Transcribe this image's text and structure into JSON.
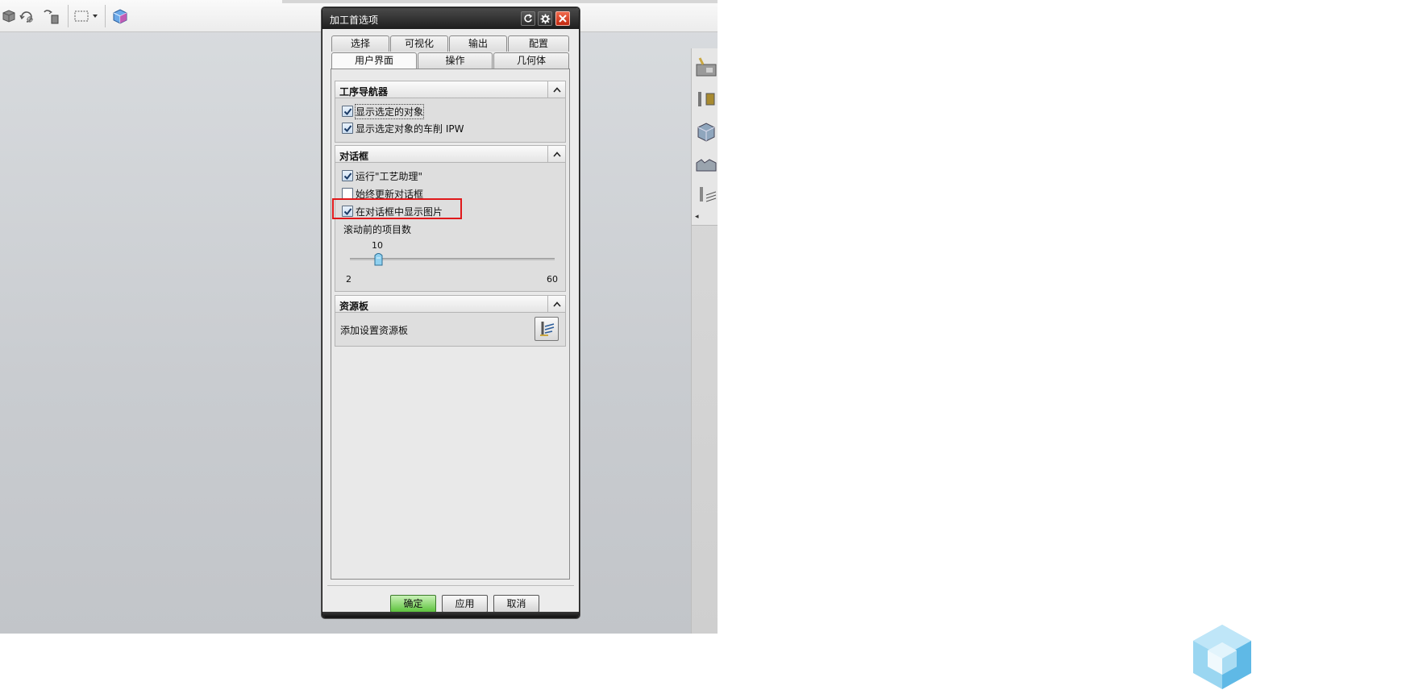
{
  "dialog": {
    "title": "加工首选项"
  },
  "tabs": {
    "row1": [
      "选择",
      "可视化",
      "输出",
      "配置"
    ],
    "row2": [
      "用户界面",
      "操作",
      "几何体"
    ],
    "active": "用户界面"
  },
  "groups": {
    "navigator": {
      "title": "工序导航器",
      "items": [
        {
          "label": "显示选定的对象",
          "checked": true
        },
        {
          "label": "显示选定对象的车削 IPW",
          "checked": true
        }
      ]
    },
    "dialog_box": {
      "title": "对话框",
      "items": [
        {
          "label": "运行\"工艺助理\"",
          "checked": true
        },
        {
          "label": "始终更新对话框",
          "checked": false
        },
        {
          "label": "在对话框中显示图片",
          "checked": true
        }
      ],
      "slider": {
        "label": "滚动前的项目数",
        "value": "10",
        "min": "2",
        "max": "60",
        "numeric_value": 10,
        "numeric_min": 2,
        "numeric_max": 60
      }
    },
    "resource": {
      "title": "资源板",
      "label": "添加设置资源板"
    }
  },
  "buttons": {
    "ok": "确定",
    "apply": "应用",
    "cancel": "取消"
  },
  "colors": {
    "highlight": "#e0191b",
    "ok_button": "#5dc23d",
    "close_button": "#d2361b",
    "titlebar": "#1e1e1e"
  }
}
